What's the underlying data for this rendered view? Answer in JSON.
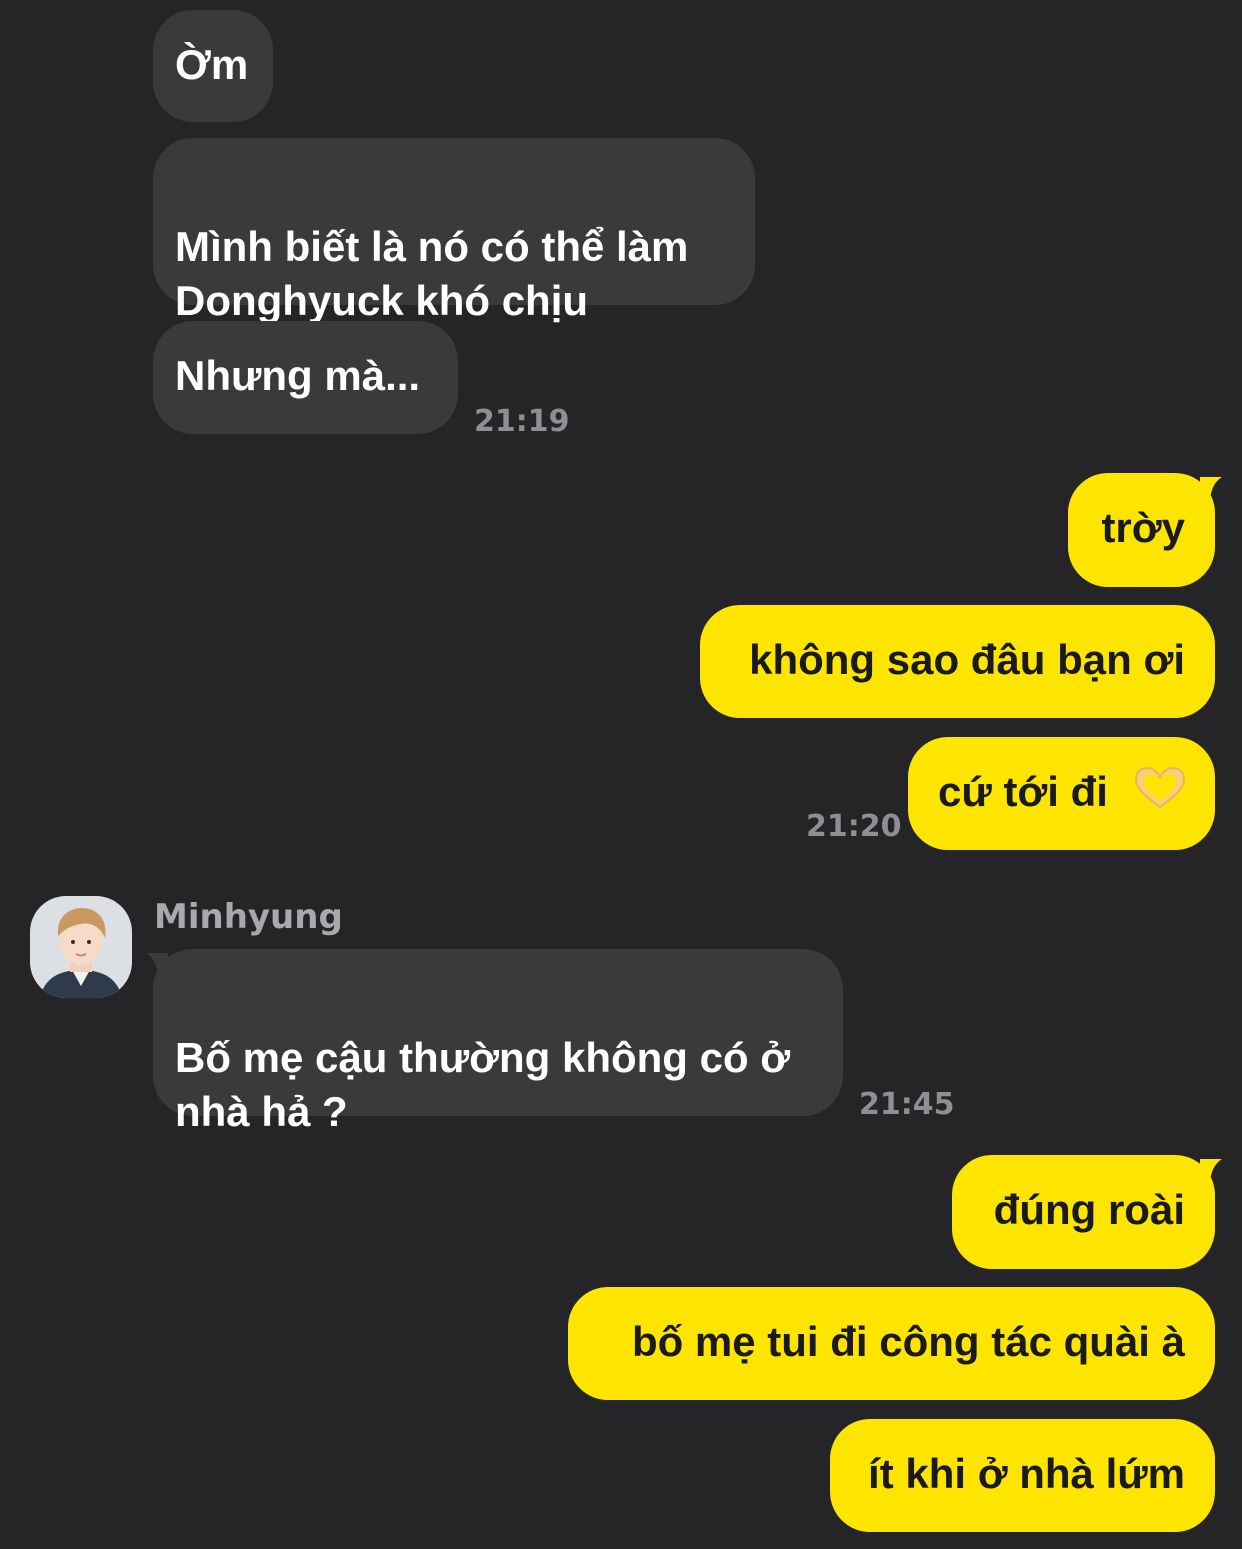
{
  "chat": {
    "messages": [
      {
        "side": "in",
        "text": "Ờm"
      },
      {
        "side": "in",
        "text": "Mình biết là nó có thể làm\nDonghyuck khó chịu"
      },
      {
        "side": "in",
        "text": "Nhưng mà..."
      },
      {
        "side": "out",
        "text": "trờy"
      },
      {
        "side": "out",
        "text": "không sao đâu bạn ơi"
      },
      {
        "side": "out",
        "text": "cứ tới đi",
        "emoji": "heart-hands"
      },
      {
        "side": "in",
        "text": "Bố mẹ cậu thường không có ở\nnhà hả ?"
      },
      {
        "side": "out",
        "text": "đúng roài"
      },
      {
        "side": "out",
        "text": "bố mẹ tui đi công tác quài à"
      },
      {
        "side": "out",
        "text": "ít khi ở nhà lứm"
      }
    ],
    "times": {
      "t1": "21:19",
      "t2": "21:20",
      "t3": "21:45"
    },
    "sender_name": "Minhyung",
    "avatar_icon": "profile-photo",
    "colors": {
      "background": "#252527",
      "incoming_bubble": "#3a3a3c",
      "outgoing_bubble": "#fee500",
      "timestamp": "#8e8e93"
    }
  }
}
